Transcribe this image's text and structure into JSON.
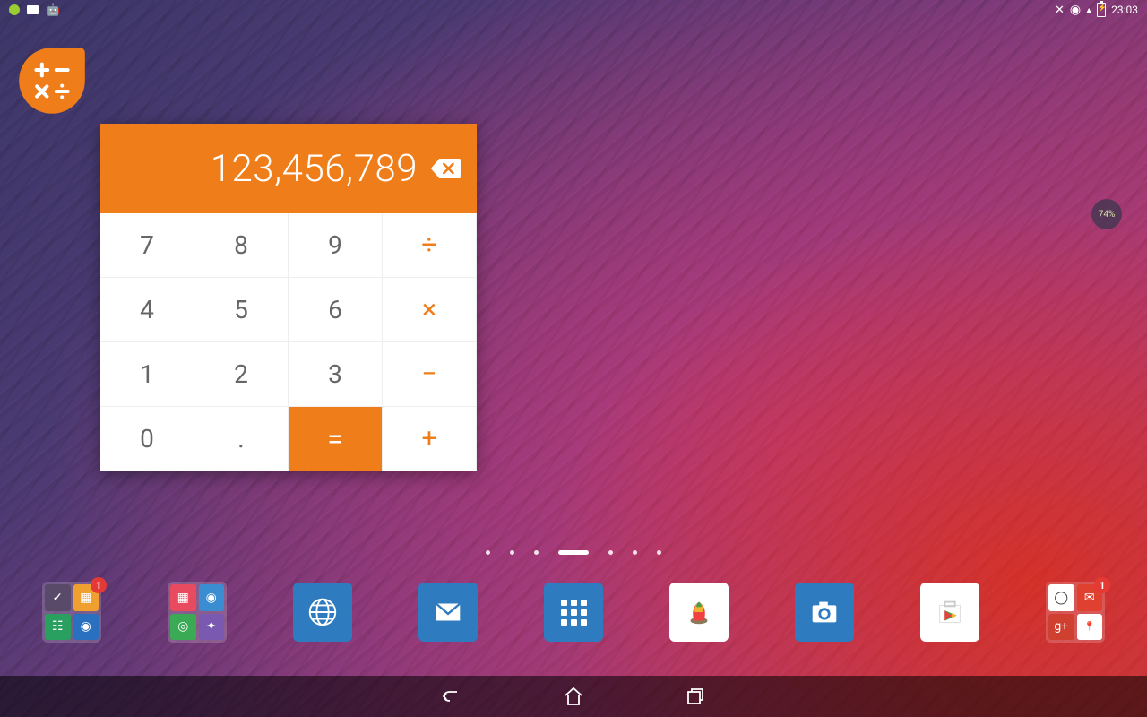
{
  "status": {
    "time": "23:03",
    "battery_pct": "74%"
  },
  "calc": {
    "display": "123,456,789",
    "keys": [
      {
        "l": "7",
        "t": "n"
      },
      {
        "l": "8",
        "t": "n"
      },
      {
        "l": "9",
        "t": "n"
      },
      {
        "l": "÷",
        "t": "op"
      },
      {
        "l": "4",
        "t": "n"
      },
      {
        "l": "5",
        "t": "n"
      },
      {
        "l": "6",
        "t": "n"
      },
      {
        "l": "×",
        "t": "op"
      },
      {
        "l": "1",
        "t": "n"
      },
      {
        "l": "2",
        "t": "n"
      },
      {
        "l": "3",
        "t": "n"
      },
      {
        "l": "−",
        "t": "op"
      },
      {
        "l": "0",
        "t": "n"
      },
      {
        "l": ".",
        "t": "n"
      },
      {
        "l": "=",
        "t": "eq"
      },
      {
        "l": "+",
        "t": "op"
      }
    ]
  },
  "pages": {
    "count": 7,
    "active": 3
  },
  "dock": {
    "folder1_badge": "1",
    "folder2_badge": "1"
  }
}
